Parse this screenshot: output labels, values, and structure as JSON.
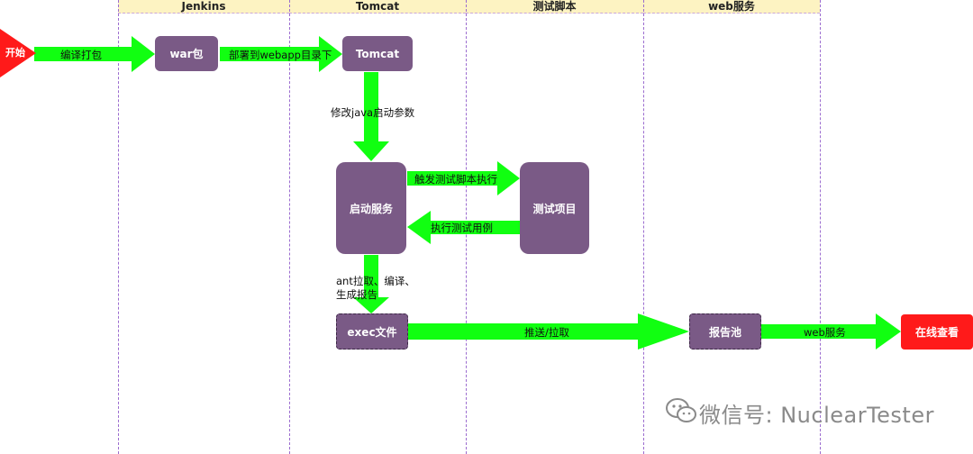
{
  "lanes": [
    "Jenkins",
    "Tomcat",
    "测试脚本",
    "web服务"
  ],
  "start_label": "开始",
  "nodes": {
    "war": "war包",
    "tomcat": "Tomcat",
    "start_service": "启动服务",
    "test_project": "测试项目",
    "exec_file": "exec文件",
    "report_pool": "报告池",
    "online_view": "在线查看"
  },
  "edges": {
    "compile": "编译打包",
    "deploy": "部署到webapp目录下",
    "modify_java": "修改java启动参数",
    "trigger_script": "触发测试脚本执行",
    "run_cases": "执行测试用例",
    "ant_line1": "ant拉取、编译、",
    "ant_line2": "生成报告",
    "push_pull": "推送/拉取",
    "web_service": "web服务"
  },
  "watermark": {
    "text": "微信号: NuclearTester",
    "icon": "wechat-icon"
  },
  "colors": {
    "arrow": "#11ff11",
    "node": "#7a5a86",
    "start": "#ff1a1a",
    "lane_header": "#fdf3c2",
    "lane_border": "#9b6ccf"
  }
}
